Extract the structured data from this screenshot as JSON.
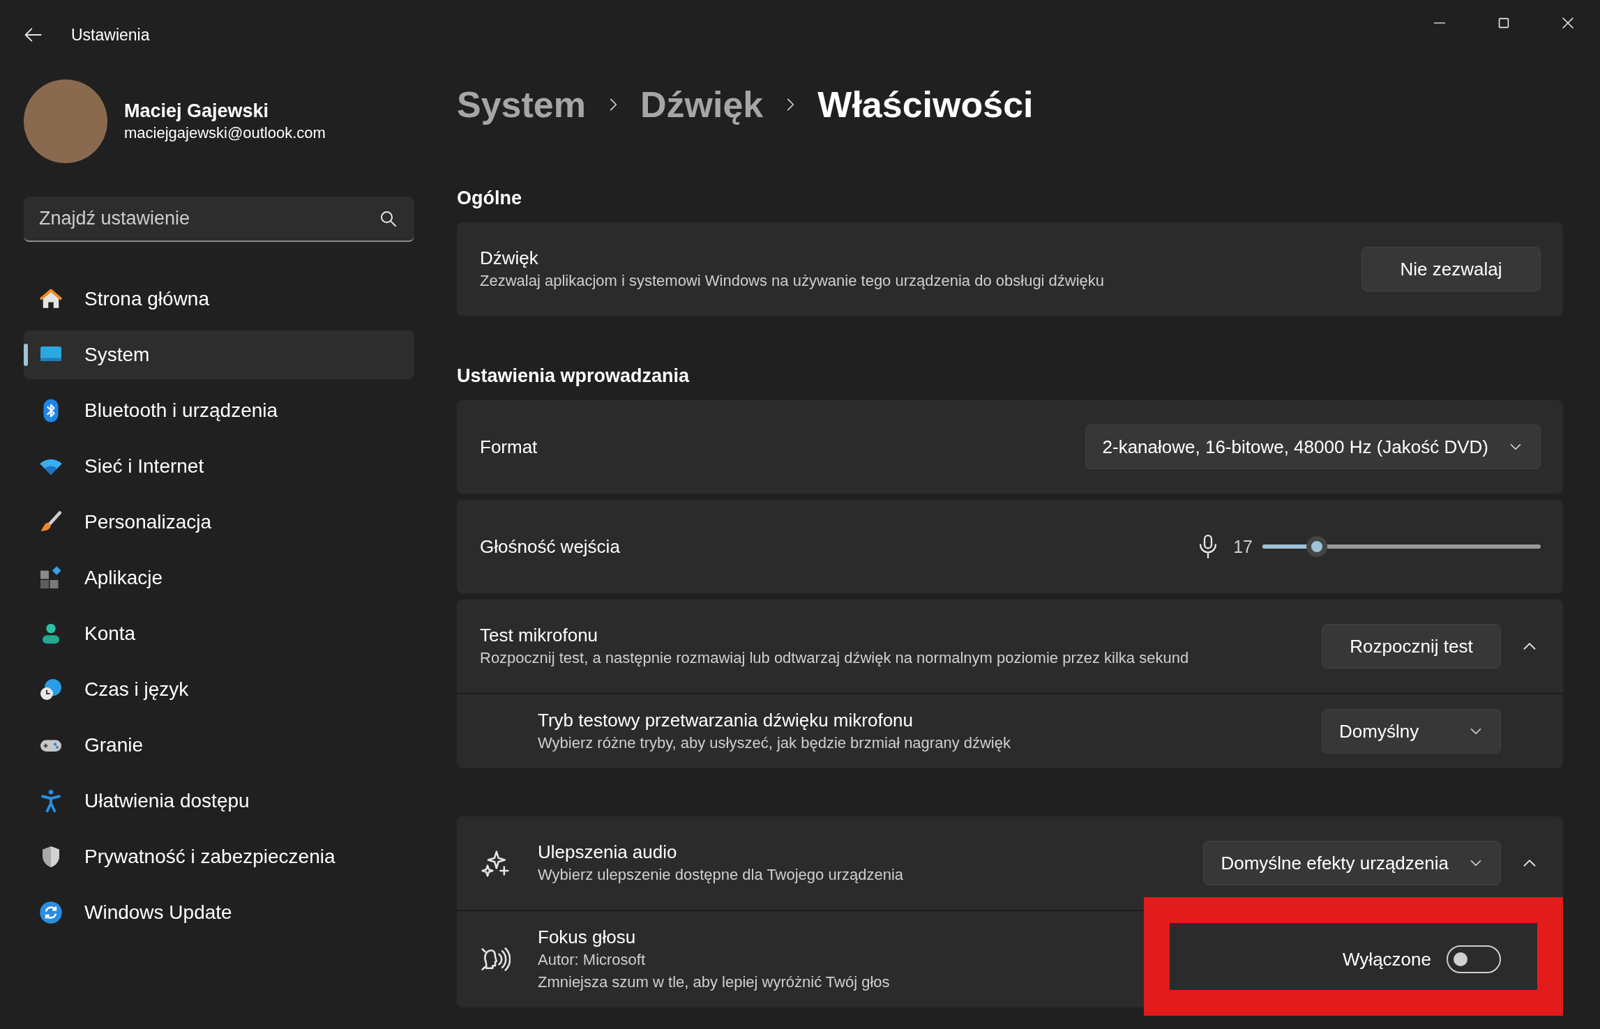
{
  "window": {
    "title": "Ustawienia"
  },
  "profile": {
    "name": "Maciej Gajewski",
    "email": "maciejgajewski@outlook.com"
  },
  "search": {
    "placeholder": "Znajdź ustawienie"
  },
  "nav": [
    {
      "label": "Strona główna",
      "selected": false
    },
    {
      "label": "System",
      "selected": true
    },
    {
      "label": "Bluetooth i urządzenia",
      "selected": false
    },
    {
      "label": "Sieć i Internet",
      "selected": false
    },
    {
      "label": "Personalizacja",
      "selected": false
    },
    {
      "label": "Aplikacje",
      "selected": false
    },
    {
      "label": "Konta",
      "selected": false
    },
    {
      "label": "Czas i język",
      "selected": false
    },
    {
      "label": "Granie",
      "selected": false
    },
    {
      "label": "Ułatwienia dostępu",
      "selected": false
    },
    {
      "label": "Prywatność i zabezpieczenia",
      "selected": false
    },
    {
      "label": "Windows Update",
      "selected": false
    }
  ],
  "breadcrumb": [
    {
      "label": "System",
      "selected": false
    },
    {
      "label": "Dźwięk",
      "selected": false
    },
    {
      "label": "Właściwości",
      "selected": true
    }
  ],
  "sections": [
    {
      "heading": "Ogólne",
      "cards": [
        {
          "kind": "button",
          "title": "Dźwięk",
          "description": "Zezwalaj aplikacjom i systemowi Windows na używanie tego urządzenia do obsługi dźwięku",
          "button": "Nie zezwalaj"
        }
      ]
    },
    {
      "heading": "Ustawienia wprowadzania",
      "cards": [
        {
          "kind": "dropdown",
          "title": "Format",
          "value": "2-kanałowe, 16-bitowe, 48000 Hz (Jakość DVD)"
        },
        {
          "kind": "slider",
          "title": "Głośność wejścia",
          "reading": "17",
          "level": 0.17
        },
        {
          "kind": "button",
          "title": "Test mikrofonu",
          "description": "Rozpocznij test, a następnie rozmawiaj lub odtwarzaj dźwięk na normalnym poziomie przez kilka sekund",
          "button": "Rozpocznij test",
          "expanded": true,
          "children": [
            {
              "kind": "dropdown",
              "title": "Tryb testowy przetwarzania dźwięku mikrofonu",
              "description": "Wybierz różne tryby, aby usłyszeć, jak będzie brzmiał nagrany dźwięk",
              "value": "Domyślny"
            }
          ]
        }
      ]
    },
    {
      "cards": [
        {
          "kind": "dropdown",
          "title": "Ulepszenia audio",
          "description": "Wybierz ulepszenie dostępne dla Twojego urządzenia",
          "value": "Domyślne efekty urządzenia",
          "expanded": true,
          "children": [
            {
              "kind": "toggle",
              "title": "Fokus głosu",
              "subtitle": "Autor: Microsoft",
              "description": "Zmniejsza szum w tle, aby lepiej wyróżnić Twój głos",
              "state_label": "Wyłączone",
              "on": false,
              "highlighted": true
            }
          ]
        }
      ]
    }
  ]
}
